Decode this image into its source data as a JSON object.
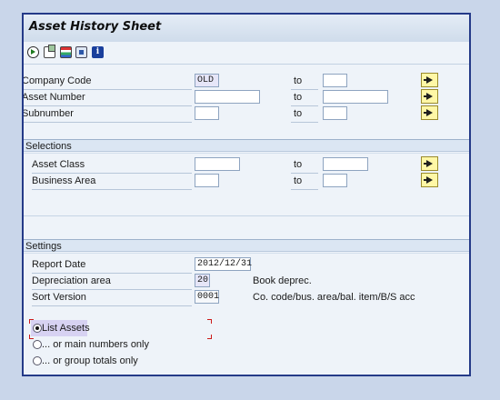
{
  "window": {
    "title": "Asset History Sheet"
  },
  "toolbar": {
    "icons": [
      "execute-icon",
      "get-variant-icon",
      "selection-options-icon",
      "dynamic-selections-icon",
      "info-icon"
    ],
    "info_glyph": "i"
  },
  "main": {
    "company_code": {
      "label": "Company Code",
      "from": "OLD",
      "to_label": "to",
      "to": ""
    },
    "asset_number": {
      "label": "Asset Number",
      "from": "",
      "to_label": "to",
      "to": ""
    },
    "subnumber": {
      "label": "Subnumber",
      "from": "",
      "to_label": "to",
      "to": ""
    }
  },
  "selections": {
    "header": "Selections",
    "asset_class": {
      "label": "Asset Class",
      "from": "",
      "to_label": "to",
      "to": ""
    },
    "business_area": {
      "label": "Business Area",
      "from": "",
      "to_label": "to",
      "to": ""
    }
  },
  "settings": {
    "header": "Settings",
    "report_date": {
      "label": "Report Date",
      "value": "2012/12/31"
    },
    "depreciation_area": {
      "label": "Depreciation area",
      "value": "20",
      "description": "Book deprec."
    },
    "sort_version": {
      "label": "Sort Version",
      "value": "0001",
      "description": "Co. code/bus. area/bal. item/B/S acc"
    }
  },
  "options": [
    {
      "label": "List Assets",
      "selected": true
    },
    {
      "label": "... or main numbers only",
      "selected": false
    },
    {
      "label": "... or group totals only",
      "selected": false
    }
  ]
}
